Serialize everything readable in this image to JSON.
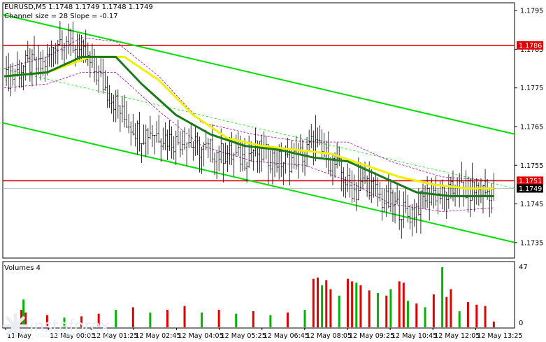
{
  "window": {
    "symbol_info": "EURUSD,M5  1.1748 1.1749 1.1748 1.1749",
    "indicator_info": "Channel size = 28  Slope = -0.17"
  },
  "volume_panel": {
    "title": "Volumes 4",
    "scale_max": "47",
    "scale_min": "0"
  },
  "watermark": {
    "brand": "instaforex",
    "tagline": "Instant Forex Trading"
  },
  "colors": {
    "background": "#ffffff",
    "candle": "#000000",
    "channel": "#00e000",
    "level_line": "#e00000",
    "ma_fast": "#f0f000",
    "ma_slow": "#1a7a1a",
    "envelope": "#b000b0",
    "volume_up": "#00b400",
    "volume_down": "#e00000"
  },
  "chart_data": {
    "type": "candlestick",
    "symbol": "EURUSD",
    "timeframe": "M5",
    "ylim": [
      1.1731,
      1.1797
    ],
    "y_ticks": [
      1.1795,
      1.1785,
      1.1775,
      1.1765,
      1.1755,
      1.1745,
      1.1735
    ],
    "x_ticks": [
      "11 May",
      "12 May 00:05",
      "12 May 01:25",
      "12 May 02:45",
      "12 May 04:05",
      "12 May 05:25",
      "12 May 06:45",
      "12 May 08:05",
      "12 May 09:25",
      "12 May 10:45",
      "12 May 12:05",
      "12 May 13:25"
    ],
    "price_labels": [
      {
        "text": "1.1786",
        "value": 1.1786,
        "style": "red"
      },
      {
        "text": "1.1751",
        "value": 1.1751,
        "style": "red"
      },
      {
        "text": "1.1749",
        "value": 1.1749,
        "style": "black"
      }
    ],
    "horizontal_levels": [
      1.1786,
      1.1751
    ],
    "bid_line": 1.1749,
    "close_path": [
      [
        0,
        1.1777
      ],
      [
        4,
        1.1778
      ],
      [
        8,
        1.178
      ],
      [
        12,
        1.1781
      ],
      [
        16,
        1.178
      ],
      [
        20,
        1.1782
      ],
      [
        24,
        1.1787
      ],
      [
        28,
        1.1788
      ],
      [
        32,
        1.1786
      ],
      [
        36,
        1.1784
      ],
      [
        40,
        1.1781
      ],
      [
        44,
        1.1778
      ],
      [
        48,
        1.1774
      ],
      [
        52,
        1.1771
      ],
      [
        56,
        1.1767
      ],
      [
        60,
        1.1765
      ],
      [
        64,
        1.1763
      ],
      [
        68,
        1.1764
      ],
      [
        72,
        1.1763
      ],
      [
        76,
        1.1762
      ],
      [
        80,
        1.1761
      ],
      [
        84,
        1.1762
      ],
      [
        88,
        1.176
      ],
      [
        92,
        1.1759
      ],
      [
        96,
        1.1759
      ],
      [
        100,
        1.1758
      ],
      [
        104,
        1.1758
      ],
      [
        108,
        1.1757
      ],
      [
        112,
        1.1757
      ],
      [
        116,
        1.1759
      ],
      [
        120,
        1.1758
      ],
      [
        124,
        1.1757
      ],
      [
        128,
        1.1756
      ],
      [
        132,
        1.1756
      ],
      [
        136,
        1.1757
      ],
      [
        140,
        1.1758
      ],
      [
        144,
        1.1761
      ],
      [
        148,
        1.1758
      ],
      [
        152,
        1.1756
      ],
      [
        156,
        1.1754
      ],
      [
        160,
        1.175
      ],
      [
        164,
        1.1748
      ],
      [
        168,
        1.1751
      ],
      [
        172,
        1.1749
      ],
      [
        176,
        1.1746
      ],
      [
        180,
        1.1745
      ],
      [
        184,
        1.1744
      ],
      [
        188,
        1.1742
      ],
      [
        192,
        1.1744
      ],
      [
        196,
        1.1747
      ],
      [
        200,
        1.1748
      ],
      [
        204,
        1.1747
      ],
      [
        208,
        1.1748
      ],
      [
        212,
        1.1749
      ],
      [
        216,
        1.1748
      ],
      [
        220,
        1.1749
      ],
      [
        224,
        1.1748
      ],
      [
        228,
        1.1749
      ]
    ],
    "spikes": [
      [
        145,
        1.1768
      ],
      [
        165,
        1.1757
      ],
      [
        170,
        1.1756
      ],
      [
        182,
        1.174
      ]
    ],
    "ma_fast": [
      [
        0,
        1.1778
      ],
      [
        20,
        1.1779
      ],
      [
        40,
        1.1783
      ],
      [
        56,
        1.1783
      ],
      [
        72,
        1.1777
      ],
      [
        88,
        1.1768
      ],
      [
        104,
        1.1762
      ],
      [
        120,
        1.176
      ],
      [
        136,
        1.1759
      ],
      [
        152,
        1.1758
      ],
      [
        168,
        1.1755
      ],
      [
        184,
        1.1752
      ],
      [
        200,
        1.175
      ],
      [
        216,
        1.1749
      ],
      [
        228,
        1.1749
      ]
    ],
    "ma_slow": [
      [
        0,
        1.1778
      ],
      [
        20,
        1.1779
      ],
      [
        36,
        1.1783
      ],
      [
        52,
        1.1783
      ],
      [
        64,
        1.1776
      ],
      [
        80,
        1.1768
      ],
      [
        96,
        1.1763
      ],
      [
        112,
        1.176
      ],
      [
        128,
        1.1759
      ],
      [
        144,
        1.1757
      ],
      [
        160,
        1.1756
      ],
      [
        176,
        1.1752
      ],
      [
        192,
        1.1748
      ],
      [
        208,
        1.1747
      ],
      [
        228,
        1.1747
      ]
    ],
    "envelope_upper": [
      [
        0,
        1.178
      ],
      [
        20,
        1.1783
      ],
      [
        36,
        1.1788
      ],
      [
        52,
        1.1787
      ],
      [
        72,
        1.1778
      ],
      [
        92,
        1.1766
      ],
      [
        116,
        1.1763
      ],
      [
        140,
        1.1761
      ],
      [
        160,
        1.1761
      ],
      [
        180,
        1.1756
      ],
      [
        204,
        1.1752
      ],
      [
        228,
        1.1751
      ]
    ],
    "envelope_lower": [
      [
        0,
        1.1775
      ],
      [
        20,
        1.1776
      ],
      [
        36,
        1.1779
      ],
      [
        52,
        1.1779
      ],
      [
        72,
        1.1769
      ],
      [
        92,
        1.176
      ],
      [
        116,
        1.1756
      ],
      [
        140,
        1.1755
      ],
      [
        160,
        1.1751
      ],
      [
        180,
        1.1745
      ],
      [
        204,
        1.1743
      ],
      [
        228,
        1.1744
      ]
    ],
    "channel_upper": [
      [
        -1,
        1.1794
      ],
      [
        238,
        1.1763
      ]
    ],
    "channel_lower": [
      [
        -1,
        1.1766
      ],
      [
        238,
        1.1735
      ]
    ],
    "volume_ylim": [
      0,
      47
    ],
    "volumes": [
      {
        "i": 8,
        "v": 14,
        "c": "down"
      },
      {
        "i": 9,
        "v": 22,
        "c": "up"
      },
      {
        "i": 10,
        "v": 12,
        "c": "down"
      },
      {
        "i": 20,
        "v": 10,
        "c": "down"
      },
      {
        "i": 28,
        "v": 8,
        "c": "up"
      },
      {
        "i": 36,
        "v": 9,
        "c": "down"
      },
      {
        "i": 44,
        "v": 11,
        "c": "down"
      },
      {
        "i": 52,
        "v": 14,
        "c": "up"
      },
      {
        "i": 60,
        "v": 16,
        "c": "down"
      },
      {
        "i": 68,
        "v": 12,
        "c": "up"
      },
      {
        "i": 76,
        "v": 14,
        "c": "down"
      },
      {
        "i": 84,
        "v": 17,
        "c": "down"
      },
      {
        "i": 92,
        "v": 12,
        "c": "up"
      },
      {
        "i": 100,
        "v": 14,
        "c": "down"
      },
      {
        "i": 108,
        "v": 11,
        "c": "up"
      },
      {
        "i": 116,
        "v": 13,
        "c": "down"
      },
      {
        "i": 124,
        "v": 10,
        "c": "up"
      },
      {
        "i": 132,
        "v": 12,
        "c": "down"
      },
      {
        "i": 140,
        "v": 14,
        "c": "up"
      },
      {
        "i": 144,
        "v": 38,
        "c": "down"
      },
      {
        "i": 146,
        "v": 39,
        "c": "down"
      },
      {
        "i": 148,
        "v": 33,
        "c": "up"
      },
      {
        "i": 150,
        "v": 37,
        "c": "down"
      },
      {
        "i": 152,
        "v": 30,
        "c": "down"
      },
      {
        "i": 156,
        "v": 25,
        "c": "up"
      },
      {
        "i": 160,
        "v": 38,
        "c": "down"
      },
      {
        "i": 162,
        "v": 36,
        "c": "down"
      },
      {
        "i": 164,
        "v": 35,
        "c": "up"
      },
      {
        "i": 166,
        "v": 33,
        "c": "down"
      },
      {
        "i": 170,
        "v": 29,
        "c": "down"
      },
      {
        "i": 174,
        "v": 27,
        "c": "up"
      },
      {
        "i": 178,
        "v": 25,
        "c": "down"
      },
      {
        "i": 180,
        "v": 30,
        "c": "up"
      },
      {
        "i": 184,
        "v": 36,
        "c": "down"
      },
      {
        "i": 186,
        "v": 35,
        "c": "down"
      },
      {
        "i": 188,
        "v": 21,
        "c": "up"
      },
      {
        "i": 192,
        "v": 19,
        "c": "down"
      },
      {
        "i": 196,
        "v": 16,
        "c": "up"
      },
      {
        "i": 200,
        "v": 26,
        "c": "down"
      },
      {
        "i": 204,
        "v": 47,
        "c": "up"
      },
      {
        "i": 206,
        "v": 24,
        "c": "down"
      },
      {
        "i": 208,
        "v": 30,
        "c": "down"
      },
      {
        "i": 212,
        "v": 13,
        "c": "up"
      },
      {
        "i": 216,
        "v": 20,
        "c": "down"
      },
      {
        "i": 220,
        "v": 18,
        "c": "down"
      },
      {
        "i": 224,
        "v": 17,
        "c": "down"
      },
      {
        "i": 228,
        "v": 5,
        "c": "down"
      }
    ]
  }
}
